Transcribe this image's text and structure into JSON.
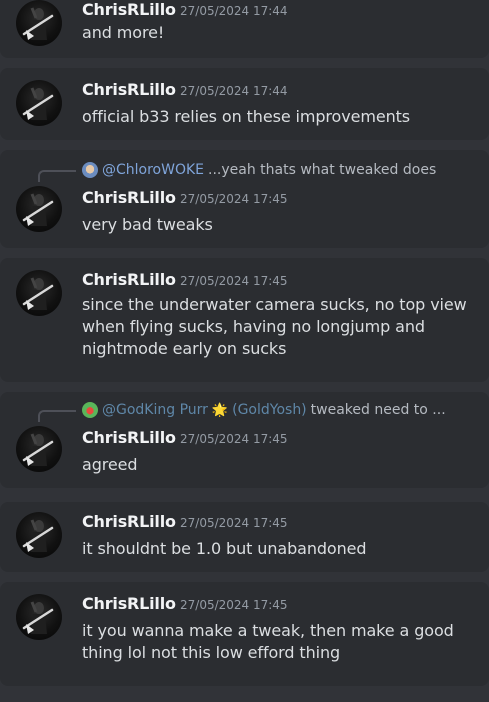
{
  "messages": [
    {
      "author": "ChrisRLillo",
      "timestamp": "27/05/2024 17:44",
      "text": "and more!"
    },
    {
      "author": "ChrisRLillo",
      "timestamp": "27/05/2024 17:44",
      "text": "official b33 relies on these improvements"
    },
    {
      "author": "ChrisRLillo",
      "timestamp": "27/05/2024 17:45",
      "text": "very bad tweaks",
      "reply": {
        "mention": "@ChloroWOKE",
        "preview": "...yeah thats what tweaked does"
      }
    },
    {
      "author": "ChrisRLillo",
      "timestamp": "27/05/2024 17:45",
      "text": "since the underwater camera sucks, no top view when flying sucks, having no longjump and nightmode early on sucks"
    },
    {
      "author": "ChrisRLillo",
      "timestamp": "27/05/2024 17:45",
      "text": "agreed",
      "reply": {
        "mention": "@GodKing Purr",
        "badge": "🌟",
        "handle": "(GoldYosh)",
        "preview": "tweaked need to ..."
      }
    },
    {
      "author": "ChrisRLillo",
      "timestamp": "27/05/2024 17:45",
      "text": "it shouldnt be 1.0 but unabandoned"
    },
    {
      "author": "ChrisRLillo",
      "timestamp": "27/05/2024 17:45",
      "text": "it you wanna make a tweak, then make a good thing lol not this low efford thing"
    }
  ],
  "colors": {
    "background": "#313338",
    "card": "#2b2d31",
    "username": "#f2f3f5",
    "message_text": "#dbdee1",
    "timestamp": "#949ba4",
    "mention": "#7fa4d9"
  }
}
